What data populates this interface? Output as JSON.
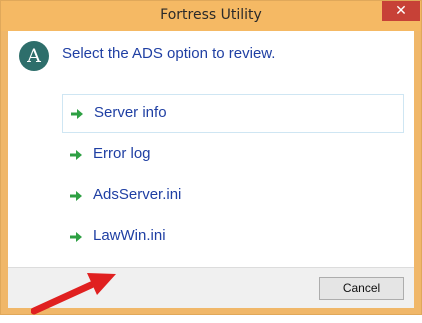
{
  "window": {
    "title": "Fortress Utility",
    "close_glyph": "✕"
  },
  "header": {
    "logo_letter": "A",
    "instruction": "Select the ADS option to review."
  },
  "options": [
    {
      "label": "Server info",
      "icon": "green-right-arrow-icon"
    },
    {
      "label": "Error log",
      "icon": "green-right-arrow-icon"
    },
    {
      "label": "AdsServer.ini",
      "icon": "green-right-arrow-icon"
    },
    {
      "label": "LawWin.ini",
      "icon": "green-right-arrow-icon"
    }
  ],
  "footer": {
    "cancel_label": "Cancel"
  },
  "colors": {
    "titlebar": "#f5b964",
    "close_button": "#c74137",
    "link_text": "#1f3fa3",
    "arrow_green": "#2ea043",
    "annotation_red": "#e02020"
  }
}
